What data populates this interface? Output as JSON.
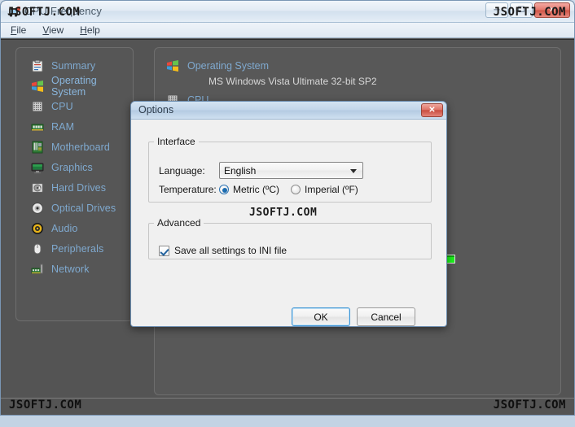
{
  "window": {
    "title": "CPU Frequency",
    "icon": "app-icon",
    "buttons": [
      {
        "name": "minimize-button",
        "glyph": "─"
      },
      {
        "name": "maximize-button",
        "glyph": "☐"
      },
      {
        "name": "close-button",
        "glyph": "✕"
      }
    ]
  },
  "menubar": {
    "items": [
      {
        "accel": "F",
        "rest": "ile"
      },
      {
        "accel": "V",
        "rest": "iew"
      },
      {
        "accel": "H",
        "rest": "elp"
      }
    ]
  },
  "sidebar": {
    "items": [
      {
        "label": "Summary",
        "icon": "clipboard-icon"
      },
      {
        "label": "Operating System",
        "icon": "windows-logo-icon"
      },
      {
        "label": "CPU",
        "icon": "cpu-chip-icon"
      },
      {
        "label": "RAM",
        "icon": "memory-module-icon"
      },
      {
        "label": "Motherboard",
        "icon": "motherboard-icon"
      },
      {
        "label": "Graphics",
        "icon": "monitor-icon"
      },
      {
        "label": "Hard Drives",
        "icon": "hard-disk-icon"
      },
      {
        "label": "Optical Drives",
        "icon": "optical-disc-icon"
      },
      {
        "label": "Audio",
        "icon": "speaker-icon"
      },
      {
        "label": "Peripherals",
        "icon": "mouse-icon"
      },
      {
        "label": "Network",
        "icon": "network-card-icon"
      }
    ]
  },
  "content": {
    "os_heading": "Operating System",
    "os_value": "MS Windows Vista Ultimate 32-bit SP2",
    "cpu_heading": "CPU",
    "indicator_color": "#1cf11c"
  },
  "dialog": {
    "title": "Options",
    "close_glyph": "✕",
    "interface": {
      "legend": "Interface",
      "language_label": "Language:",
      "language_value": "English",
      "language_options": [
        "English"
      ],
      "temperature_label": "Temperature:",
      "metric_label": "Metric (ºC)",
      "imperial_label": "Imperial (ºF)",
      "temperature_selected": "metric"
    },
    "advanced": {
      "legend": "Advanced",
      "save_ini_label": "Save all settings to INI file",
      "save_ini_checked": true
    },
    "ok_label": "OK",
    "cancel_label": "Cancel"
  },
  "watermarks": {
    "text": "JSOFTJ.COM"
  }
}
